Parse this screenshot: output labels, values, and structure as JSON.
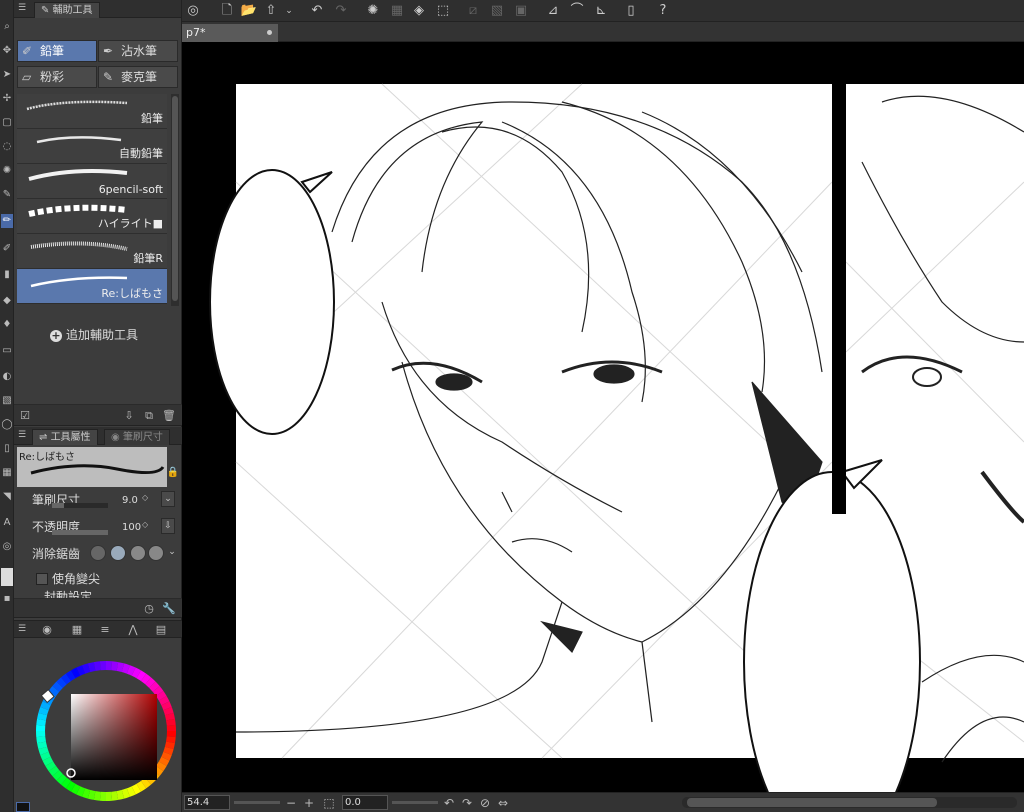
{
  "subtool_panel": {
    "tab_label": "輔助工具",
    "groups": [
      {
        "label": "鉛筆",
        "icon": "pencil-icon",
        "active": true
      },
      {
        "label": "沾水筆",
        "icon": "pen-nib-icon",
        "active": false
      },
      {
        "label": "粉彩",
        "icon": "pastel-icon",
        "active": false
      },
      {
        "label": "麥克筆",
        "icon": "marker-icon",
        "active": false
      }
    ],
    "brushes": [
      {
        "name": "鉛筆",
        "selected": false
      },
      {
        "name": "自動鉛筆",
        "selected": false
      },
      {
        "name": "6pencil-soft",
        "selected": false
      },
      {
        "name": "ハイライト■",
        "selected": false
      },
      {
        "name": "鉛筆R",
        "selected": false
      },
      {
        "name": "Re:しばもさ",
        "selected": true
      }
    ],
    "add_label": "追加輔助工具"
  },
  "tool_property": {
    "tab_label": "工具屬性",
    "tab2_label": "筆刷尺寸",
    "preview_name": "Re:しばもさ",
    "rows": [
      {
        "label": "筆刷尺寸",
        "value": "9.0",
        "fill": 0.22
      },
      {
        "label": "不透明度",
        "value": "100",
        "fill": 1.0
      }
    ],
    "antialias_label": "消除鋸齒",
    "corner_label": "使角變尖",
    "cut_label": "封動設定"
  },
  "document": {
    "tab_label": "p7*"
  },
  "status": {
    "zoom": "54.4",
    "angle": "0.0"
  },
  "colors": {
    "accent": "#5a78ad",
    "main_color": "#b00000"
  }
}
